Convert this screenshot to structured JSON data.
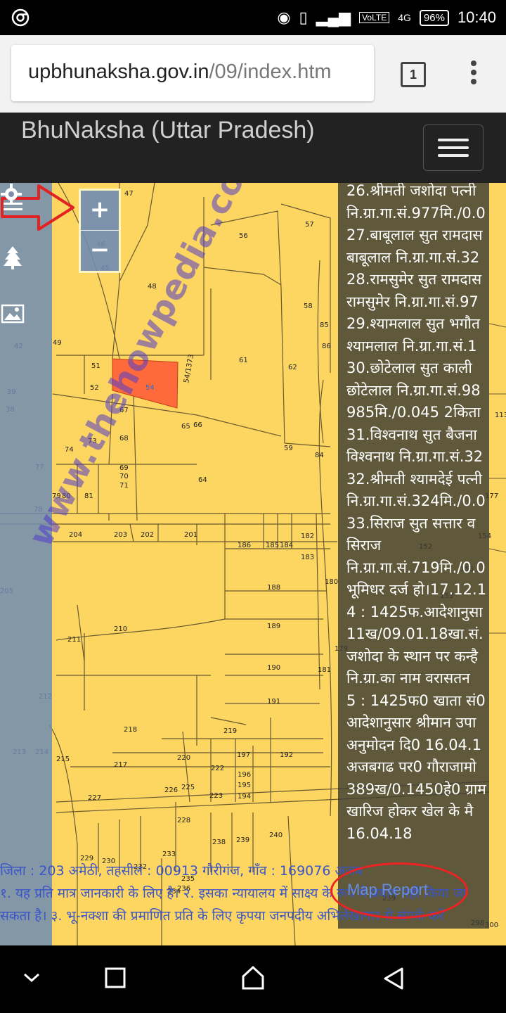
{
  "status_bar": {
    "time": "10:40",
    "battery": "96%",
    "network_tag": "VoLTE",
    "network_gen": "4G"
  },
  "browser": {
    "url_domain": "upbhunaksha.gov.in",
    "url_path": "/09/index.htm",
    "tab_count": "1"
  },
  "app": {
    "title": "BhuNaksha (Uttar Pradesh)"
  },
  "map": {
    "zoom_in": "+",
    "zoom_out": "−",
    "watermark": "www.thehowpedia.com",
    "plot_numbers": [
      "47",
      "56",
      "57",
      "46",
      "45",
      "48",
      "58",
      "85",
      "86",
      "61",
      "62",
      "49",
      "42",
      "51",
      "52",
      "54",
      "54/1373",
      "67",
      "65",
      "66",
      "73",
      "68",
      "74",
      "59",
      "84",
      "39",
      "38",
      "77",
      "69",
      "70",
      "71",
      "64",
      "80",
      "81",
      "78",
      "79",
      "204",
      "203",
      "202",
      "201",
      "186",
      "185",
      "184",
      "182",
      "183",
      "180",
      "205",
      "188",
      "210",
      "211",
      "189",
      "190",
      "181",
      "179",
      "212",
      "191",
      "218",
      "219",
      "213",
      "214",
      "215",
      "220",
      "217",
      "222",
      "197",
      "196",
      "195",
      "194",
      "192",
      "227",
      "226",
      "225",
      "223",
      "228",
      "240",
      "238",
      "239",
      "229",
      "230",
      "233",
      "232",
      "234",
      "236",
      "235",
      "113",
      "154",
      "152",
      "155",
      "153",
      "259",
      "298",
      "300",
      "177"
    ]
  },
  "info_panel": {
    "lines": [
      "26.श्रीमती जशोदा पत्नी",
      "नि.ग्रा.गा.सं.977मि./0.0",
      "27.बाबूलाल सुत रामदास",
      "बाबूलाल नि.ग्रा.गा.सं.32",
      "28.रामसुमेर सुत रामदास",
      "रामसुमेर नि.ग्रा.गा.सं.97",
      "29.श्यामलाल सुत भगौत",
      "श्यामलाल नि.ग्रा.गा.सं.1",
      "30.छोटेलाल सुत काली",
      "छोटेलाल नि.ग्रा.गा.सं.98",
      "985मि./0.045 2किता",
      "31.विश्वनाथ सुत बैजना",
      "विश्वनाथ नि.ग्रा.गा.सं.32",
      "32.श्रीमती श्यामदेई पत्नी",
      "नि.ग्रा.गा.सं.324मि./0.0",
      "33.सिराज सुत सत्तार व",
      "सिराज",
      "नि.ग्रा.गा.सं.719मि./0.0",
      "भूमिधर दर्ज हो।17.12.1",
      "4 : 1425फ.आदेशानुसा",
      "11ख/09.01.18खा.सं.",
      "जशोदा के स्थान पर कन्है",
      "नि.ग्रा.का नाम वरासतन",
      "5 : 1425फ0 खाता सं0",
      "आदेशानुसार श्रीमान उपा",
      "अनुमोदन दि0 16.04.1",
      "अजबगढ पर0 गौराजामो",
      "389ख/0.1450हे0 ग्राम",
      "खारिज होकर खेल के मै",
      "16.04.18"
    ],
    "map_report": "Map Report"
  },
  "footer": {
    "line1": "जिला : 203 अमेठी, तहसील : 00913 गौरीगंज, गाँव : 169076 अजब",
    "line2": "१. यह प्रति मात्र जानकारी के लिए है। २. इसका न्यायालय में साक्ष्य के रूप में प्रयोग नहीं किया जा",
    "line3": "सकता है। ३. भू-नक्शा की प्रमाणित प्रति के लिए कृपया जनपदीय अभिलेखागार से संपर्क करें"
  },
  "colors": {
    "map_fill": "#fdd561",
    "selected_plot": "#ff6a3d",
    "annotation_red": "#e22222",
    "header_bg": "#222222"
  }
}
